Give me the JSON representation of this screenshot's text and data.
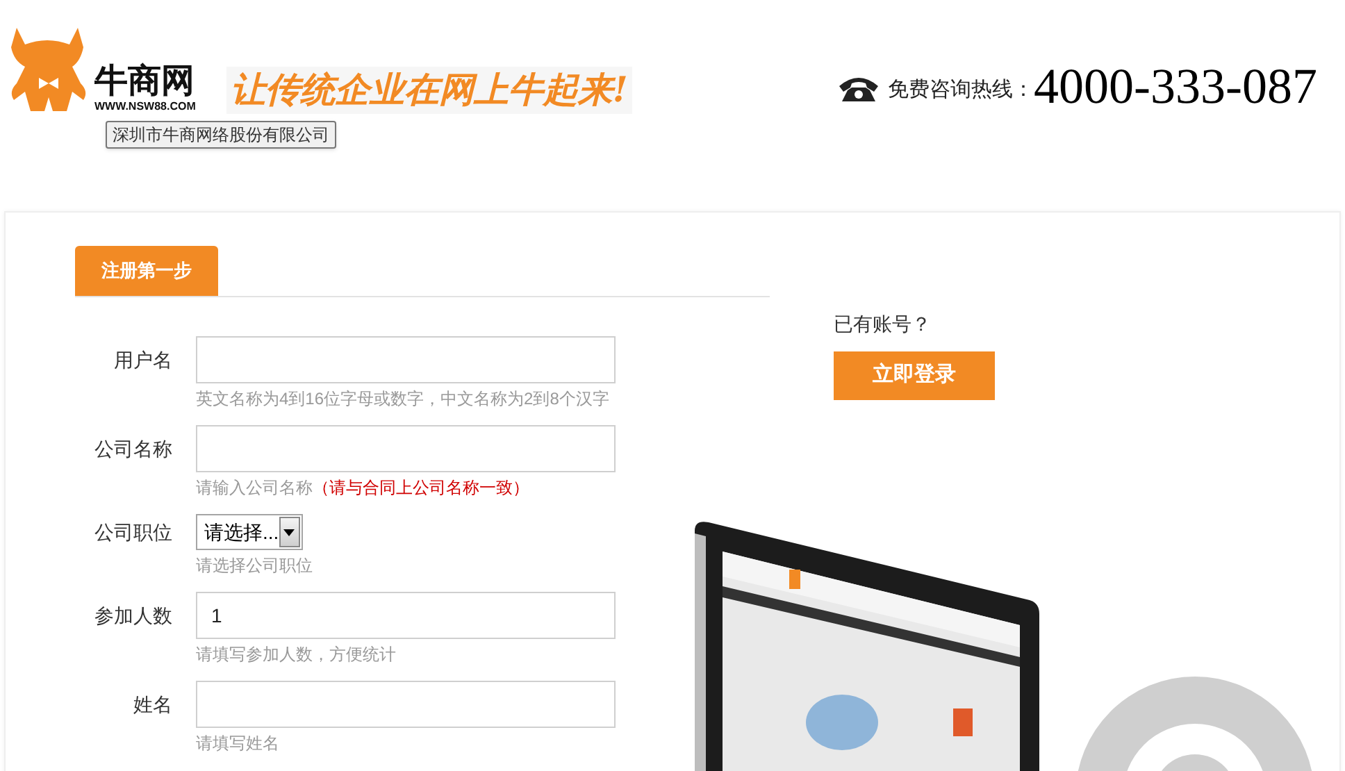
{
  "header": {
    "logo": {
      "name": "牛商网",
      "url": "WWW.NSW88.COM"
    },
    "slogan": "让传统企业在网上牛起来!",
    "tooltip": "深圳市牛商网络股份有限公司",
    "hotline": {
      "label": "免费咨询热线：",
      "number": "4000-333-087"
    }
  },
  "tabs": [
    {
      "label": "注册第一步",
      "selected": true
    }
  ],
  "fields": [
    {
      "kind": "text",
      "label": "用户名",
      "hint": "英文名称为4到16位字母或数字，中文名称为2到8个汉字"
    },
    {
      "kind": "text",
      "label": "公司名称",
      "hint": "请输入公司名称",
      "hint_note": "（请与合同上公司名称一致）"
    },
    {
      "kind": "select",
      "label": "公司职位",
      "value": "请选择...",
      "hint": "请选择公司职位"
    },
    {
      "kind": "text",
      "label": "参加人数",
      "value": "1",
      "hint": "请填写参加人数，方便统计"
    },
    {
      "kind": "text",
      "label": "姓名",
      "hint": "请填写姓名"
    }
  ],
  "login": {
    "prompt": "已有账号？",
    "button": "立即登录"
  }
}
